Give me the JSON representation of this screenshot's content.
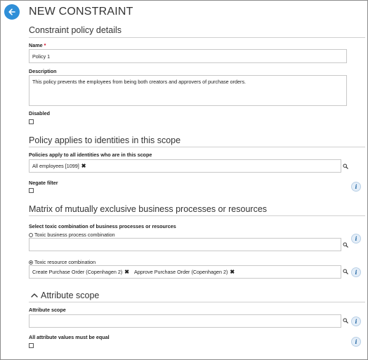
{
  "header": {
    "title": "NEW CONSTRAINT"
  },
  "sections": {
    "policy_details": "Constraint policy details",
    "scope": "Policy applies to identities in this scope",
    "matrix": "Matrix of mutually exclusive business processes or resources",
    "attribute": "Attribute scope"
  },
  "name": {
    "label": "Name",
    "required_mark": "*",
    "value": "Policy 1"
  },
  "description": {
    "label": "Description",
    "value": "This policy prevents the employees from being both creators and approvers of purchase orders."
  },
  "disabled": {
    "label": "Disabled",
    "checked": false
  },
  "scope_filter": {
    "label": "Policies apply to all identities who are in this scope",
    "tokens": [
      "All employees [1099]"
    ],
    "remove_glyph": "✖"
  },
  "negate_filter": {
    "label": "Negate filter",
    "checked": false
  },
  "matrix": {
    "label": "Select toxic combination of business processes or resources",
    "option_process": "Toxic business process combination",
    "option_resource": "Toxic resource combination",
    "selected": "resource",
    "resource_tokens": [
      "Create Purchase Order (Copenhagen 2)",
      "Approve Purchase Order (Copenhagen 2)"
    ]
  },
  "attribute_scope": {
    "label": "Attribute scope",
    "value": "",
    "equal_label": "All attribute values must be equal",
    "equal_checked": false
  },
  "icons": {
    "back": "arrow-left-icon",
    "search": "magnifier-icon",
    "info": "info-icon",
    "info_glyph": "i",
    "collapse": "chevron-up-icon"
  },
  "colors": {
    "accent": "#2f8fd8",
    "required": "#d0021b"
  }
}
